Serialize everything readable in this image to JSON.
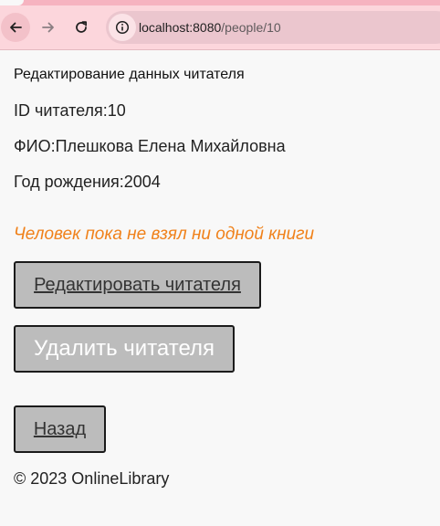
{
  "browser": {
    "url_host": "localhost:8080",
    "url_path": "/people/10",
    "icons": {
      "back": "back-arrow-icon",
      "forward": "forward-arrow-icon",
      "reload": "reload-icon",
      "site_info": "info-icon"
    },
    "colors": {
      "toolbar": "#fcd6dc",
      "omnibox": "#ebc6ce"
    }
  },
  "page": {
    "title": "Редактирование данных читателя",
    "reader_id": "ID читателя:10",
    "full_name": "ФИО:Плешкова Елена Михайловна",
    "birth_year": "Год рождения:2004",
    "no_books_message": "Человек пока не взял ни одной книги",
    "edit_button": "Редактировать читателя",
    "delete_button": "Удалить читателя",
    "back_button": "Назад",
    "footer": "© 2023 OnlineLibrary",
    "colors": {
      "accent": "#f0811a",
      "button_bg": "#bcbcbc"
    }
  }
}
